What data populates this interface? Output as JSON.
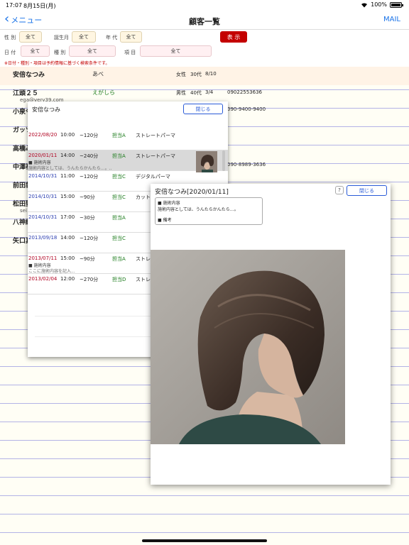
{
  "status_bar": {
    "time": "17:07",
    "date": "8月15日(月)",
    "battery": "100%"
  },
  "nav": {
    "back_label": "メニュー",
    "title": "顧客一覧",
    "mail_label": "MAIL"
  },
  "filters": {
    "gender_label": "性 別",
    "gender_value": "全て",
    "birth_month_label": "誕生月",
    "birth_month_value": "全て",
    "age_label": "年 代",
    "age_value": "全て",
    "show_label": "表 示",
    "date_label": "日 付",
    "date_value": "全て",
    "type_label": "種 別",
    "type_value": "全て",
    "item_label": "項 目",
    "item_value": "全て",
    "note": "※日付・種別・項目は予約情報に基づく検索条件です。"
  },
  "customers": [
    {
      "name": "安倍なつみ",
      "kana": "あべ",
      "gender": "女性",
      "age": "30代",
      "birthday": "8/10",
      "phone": "",
      "email": ""
    },
    {
      "name": "江頭２５",
      "kana": "えがしら",
      "gender": "男性",
      "age": "40代",
      "birthday": "3/4",
      "phone": "09022553636",
      "email": "ega@very39.com"
    },
    {
      "name": "小泉今",
      "kana": "",
      "gender": "",
      "age": "",
      "birthday": "",
      "phone": "090-9400-9400",
      "email": ""
    },
    {
      "name": "ガッツ",
      "kana": "",
      "gender": "",
      "age": "",
      "birthday": "",
      "phone": "",
      "email": ""
    },
    {
      "name": "高橋み",
      "kana": "",
      "gender": "",
      "age": "",
      "birthday": "",
      "phone": "",
      "email": ""
    },
    {
      "name": "中澤裕",
      "kana": "",
      "gender": "",
      "age": "",
      "birthday": "",
      "phone": "090-8989-3636",
      "email": ""
    },
    {
      "name": "前田敦",
      "kana": "",
      "gender": "",
      "age": "",
      "birthday": "",
      "phone": "",
      "email": ""
    },
    {
      "name": "松田聖",
      "kana": "",
      "gender": "",
      "age": "",
      "birthday": "",
      "phone": "",
      "email": "sei"
    },
    {
      "name": "八神純",
      "kana": "",
      "gender": "",
      "age": "",
      "birthday": "",
      "phone": "",
      "email": ""
    },
    {
      "name": "矢口真",
      "kana": "",
      "gender": "",
      "age": "",
      "birthday": "",
      "phone": "",
      "email": ""
    }
  ],
  "history": {
    "title": "安倍なつみ",
    "close_label": "閉じる",
    "rows": [
      {
        "date": "2022/08/20",
        "time": "10:00",
        "duration": "~120分",
        "staff": "担当A",
        "menu": "ストレートパーマ",
        "note1": "",
        "note2": ""
      },
      {
        "date": "2020/01/11",
        "time": "14:00",
        "duration": "~240分",
        "staff": "担当A",
        "menu": "ストレートパーマ",
        "note1": "■ 施術内容",
        "note2": "施術内容としては、うんたらかんたら…。.."
      },
      {
        "date": "2014/10/31",
        "time": "11:00",
        "duration": "~120分",
        "staff": "担当C",
        "menu": "デジタルパーマ",
        "note1": "",
        "note2": ""
      },
      {
        "date": "2014/10/31",
        "time": "15:00",
        "duration": "~90分",
        "staff": "担当C",
        "menu": "カットのみ",
        "note1": "",
        "note2": ""
      },
      {
        "date": "2014/10/31",
        "time": "17:00",
        "duration": "~30分",
        "staff": "担当A",
        "menu": "",
        "note1": "",
        "note2": ""
      },
      {
        "date": "2013/09/18",
        "time": "14:00",
        "duration": "~120分",
        "staff": "担当C",
        "menu": "",
        "note1": "",
        "note2": ""
      },
      {
        "date": "2013/07/11",
        "time": "15:00",
        "duration": "~90分",
        "staff": "担当A",
        "menu": "ストレート",
        "note1": "■ 施術内容",
        "note2": "ここに施術内容を記入..."
      },
      {
        "date": "2013/02/04",
        "time": "12:00",
        "duration": "~270分",
        "staff": "担当D",
        "menu": "ストレート",
        "note1": "",
        "note2": ""
      }
    ]
  },
  "detail": {
    "title": "安倍なつみ[2020/01/11]",
    "help_label": "?",
    "close_label": "閉じる",
    "memo_heading": "■ 施術内容",
    "memo_text": "施術内容としては、うんたらかんたら…。",
    "remarks_heading": "■ 備考"
  },
  "colors": {
    "accent_blue": "#1a73e8",
    "show_button": "#c40000",
    "date_red": "#b00020",
    "staff_green": "#1a7a1a",
    "ruled_line": "#b3b3e6"
  }
}
